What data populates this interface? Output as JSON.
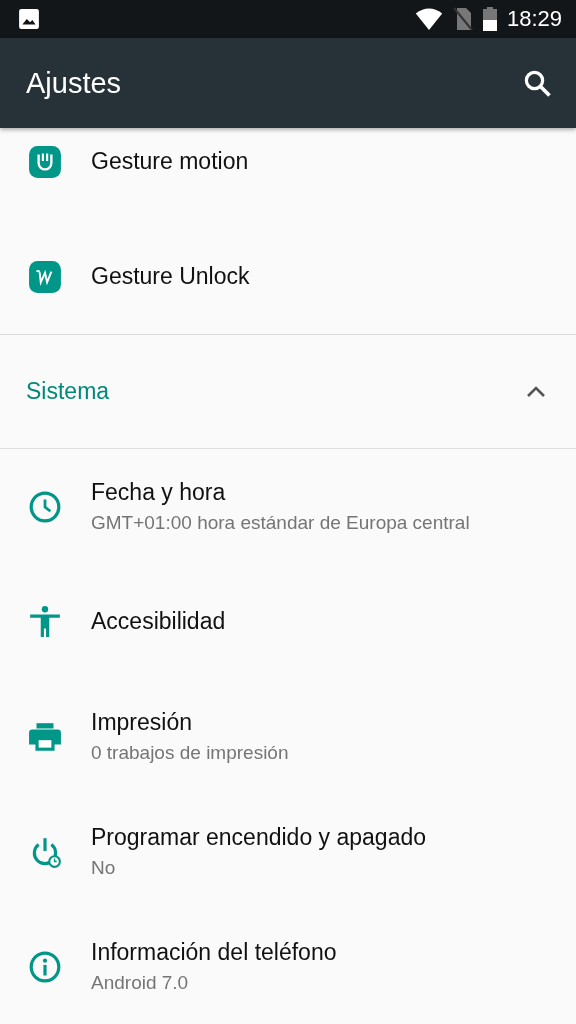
{
  "status_bar": {
    "time": "18:29"
  },
  "app_bar": {
    "title": "Ajustes"
  },
  "items": [
    {
      "kind": "setting",
      "title": "Gesture motion"
    },
    {
      "kind": "setting",
      "title": "Gesture Unlock"
    },
    {
      "kind": "header",
      "title": "Sistema",
      "expanded": true
    },
    {
      "kind": "setting",
      "title": "Fecha y hora",
      "subtitle": "GMT+01:00 hora estándar de Europa central"
    },
    {
      "kind": "setting",
      "title": "Accesibilidad"
    },
    {
      "kind": "setting",
      "title": "Impresión",
      "subtitle": "0 trabajos de impresión"
    },
    {
      "kind": "setting",
      "title": "Programar encendido y apagado",
      "subtitle": "No"
    },
    {
      "kind": "setting",
      "title": "Información del teléfono",
      "subtitle": "Android 7.0"
    }
  ]
}
